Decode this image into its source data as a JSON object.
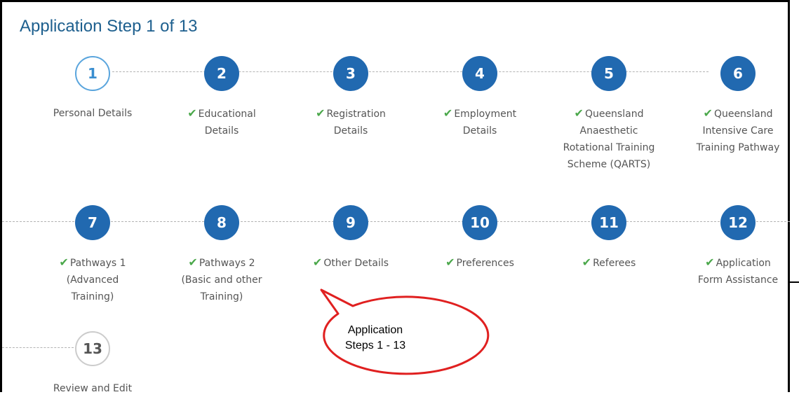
{
  "page": {
    "title": "Application Step 1 of 13"
  },
  "steps": [
    {
      "number": "1",
      "label": "Personal Details",
      "status": "current",
      "check": false
    },
    {
      "number": "2",
      "label": "Educational\nDetails",
      "status": "done",
      "check": true
    },
    {
      "number": "3",
      "label": "Registration\nDetails",
      "status": "done",
      "check": true
    },
    {
      "number": "4",
      "label": "Employment\nDetails",
      "status": "done",
      "check": true
    },
    {
      "number": "5",
      "label": "Queensland\nAnaesthetic\nRotational Training\nScheme (QARTS)",
      "status": "done",
      "check": true
    },
    {
      "number": "6",
      "label": "Queensland\nIntensive Care\nTraining Pathway",
      "status": "done",
      "check": true
    },
    {
      "number": "7",
      "label": "Pathways 1\n(Advanced\nTraining)",
      "status": "done",
      "check": true
    },
    {
      "number": "8",
      "label": "Pathways 2\n(Basic and other\nTraining)",
      "status": "done",
      "check": true
    },
    {
      "number": "9",
      "label": "Other Details",
      "status": "done",
      "check": true
    },
    {
      "number": "10",
      "label": "Preferences",
      "status": "done",
      "check": true
    },
    {
      "number": "11",
      "label": "Referees",
      "status": "done",
      "check": true
    },
    {
      "number": "12",
      "label": "Application\nForm Assistance",
      "status": "done",
      "check": true
    },
    {
      "number": "13",
      "label": "Review and Edit",
      "status": "pending",
      "check": false
    }
  ],
  "callout": {
    "line1": "Application",
    "line2": "Steps 1 - 13"
  },
  "colors": {
    "title": "#1d5f8e",
    "step_done": "#2169b0",
    "step_current_border": "#5aa5dd",
    "check": "#4ba84b",
    "callout_border": "#e02020"
  },
  "icons": {
    "check": "checkmark-icon"
  }
}
